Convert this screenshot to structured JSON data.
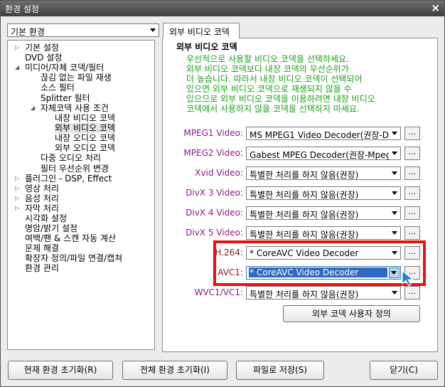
{
  "window": {
    "title": "환경 설정",
    "close_glyph": "×"
  },
  "profile": {
    "selected": "기본 환경"
  },
  "tree": {
    "items": [
      {
        "label": "기본 설정",
        "expander": "▷"
      },
      {
        "label": "DVD 설정",
        "expander": ""
      },
      {
        "label": "미디어/자체 코덱/필터",
        "expander": "◢"
      },
      {
        "label": "끊김 없는 파일 재생",
        "expander": ""
      },
      {
        "label": "소스 필터",
        "expander": ""
      },
      {
        "label": "Splitter 필터",
        "expander": ""
      },
      {
        "label": "자체코덱 사용 조건",
        "expander": "◢"
      },
      {
        "label": "내장 비디오 코덱",
        "expander": ""
      },
      {
        "label": "외부 비디오 코덱",
        "expander": ""
      },
      {
        "label": "내장 오디오 코덱",
        "expander": ""
      },
      {
        "label": "외부 오디오 코덱",
        "expander": ""
      },
      {
        "label": "다중 오디오 처리",
        "expander": ""
      },
      {
        "label": "필터 우선순위 변경",
        "expander": ""
      },
      {
        "label": "플러그인 - DSP, Effect",
        "expander": "▷"
      },
      {
        "label": "영상 처리",
        "expander": "▷"
      },
      {
        "label": "음성 처리",
        "expander": "▷"
      },
      {
        "label": "자막 처리",
        "expander": "▷"
      },
      {
        "label": "시각화 설정",
        "expander": ""
      },
      {
        "label": "명암/밝기 설정",
        "expander": ""
      },
      {
        "label": "여백/팬 & 스캔 자동 계산",
        "expander": ""
      },
      {
        "label": "문제 해결",
        "expander": ""
      },
      {
        "label": "확장자 정의/파일 연결/캡쳐",
        "expander": ""
      },
      {
        "label": "환경 관리",
        "expander": ""
      }
    ]
  },
  "tab": {
    "label": "외부 비디오 코덱"
  },
  "section": {
    "title": "외부 비디오 코덱",
    "description": [
      "우선적으로 사용할 비디오 코덱을 선택하세요.",
      "외부 비디오 코덱보다 내장 코덱의 우선순위가",
      "더 높습니다. 따라서 내장 비디오 코덱이 선택되어",
      "있으면 외부 비디오 코덱으로 재생되지 않을 수",
      "있으므로 외부 비디오 코덱을 이용하려면 내장 비디오",
      "코덱에서 사용하지 않을 코덱을 선택하지 마세요."
    ]
  },
  "codecs": [
    {
      "label": "MPEG1 Video:",
      "value": "MS MPEG1 Video Decoder(권장-D"
    },
    {
      "label": "MPEG2 Video:",
      "value": "Gabest MPEG Decoder(권장-Mpeg"
    },
    {
      "label": "Xvid Video:",
      "value": "특별한 처리를 하지 않음(권장)"
    },
    {
      "label": "DivX 3 Video:",
      "value": "특별한 처리를 하지 않음(권장)"
    },
    {
      "label": "DivX 4 Video:",
      "value": "특별한 처리를 하지 않음(권장)"
    },
    {
      "label": "DivX 5 Video:",
      "value": "특별한 처리를 하지 않음(권장)"
    },
    {
      "label": "H.264:",
      "value": "* CoreAVC Video Decoder"
    },
    {
      "label": "AVC1:",
      "value": "* CoreAVC Video Decoder"
    },
    {
      "label": "WVC1/VC1:",
      "value": "특별한 처리를 하지 않음(권장)"
    }
  ],
  "browse_label": "...",
  "custom_button": "외부 코덱 사용자 정의",
  "footer": {
    "reset_current": "현재 환경 초기화(R)",
    "reset_all": "전체 환경 초기화(I)",
    "save_file": "파일로 저장(S)",
    "close": "닫기(C)"
  },
  "colors": {
    "highlight_box": "#e81010",
    "description_text": "#1aa01a",
    "codec_label": "#8b1a8b",
    "selection": "#316ac5"
  }
}
